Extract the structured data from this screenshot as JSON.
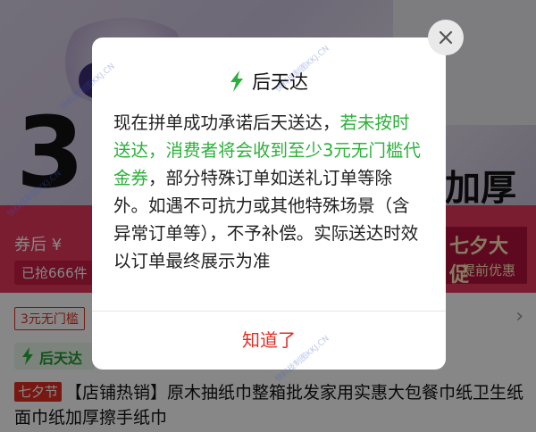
{
  "background": {
    "hero_big_number": "3",
    "hero_thick_text": "加厚",
    "promo_price_prefix": "券后 ¥",
    "promo_sold_text": "已抢666件",
    "promo_festival_title": "七夕大促",
    "promo_festival_sub": "提前优惠",
    "coupon_text": "3元无门槛",
    "chevron": "›",
    "green_tag_text": "后天达",
    "product_tag": "七夕节",
    "product_title": "【店铺热销】原木抽纸巾整箱批发家用实惠大包餐巾纸卫生纸面巾纸加厚擦手纸巾"
  },
  "modal": {
    "title": "后天达",
    "body_part1": "现在拼单成功承诺后天送达，",
    "body_highlight": "若未按时送达，消费者将会收到至少3元无门槛代金券",
    "body_part2": "，部分特殊订单如送礼订单等除外。如遇不可抗力或其他特殊场景（含异常订单等），不予补偿。实际送达时效以订单最终展示为准",
    "ok_label": "知道了"
  },
  "watermark": {
    "text": "快科技制图KKJ.CN"
  },
  "colors": {
    "accent_green": "#2db03b",
    "accent_red": "#e02e24",
    "promo_pink": "#e8375d"
  },
  "icons": {
    "title_icon": "lightning-bolt-icon",
    "close_icon": "close-icon"
  }
}
